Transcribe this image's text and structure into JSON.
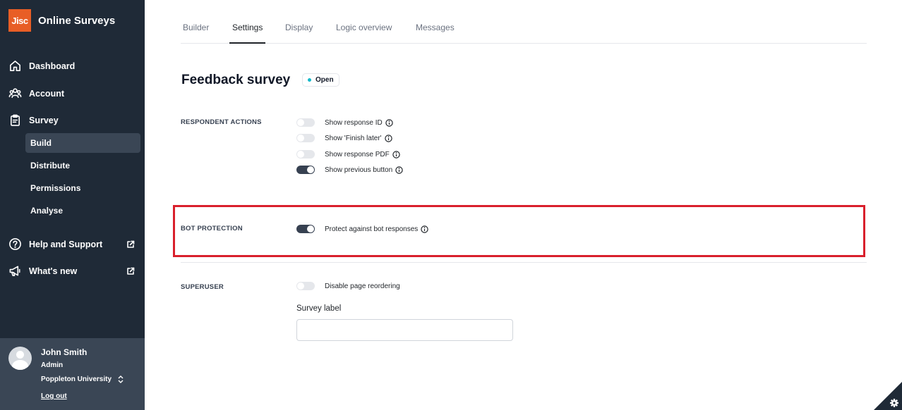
{
  "brand": {
    "logo_text": "Jisc",
    "app_name": "Online Surveys"
  },
  "nav": {
    "dashboard": "Dashboard",
    "account": "Account",
    "survey": "Survey",
    "survey_sub": [
      "Build",
      "Distribute",
      "Permissions",
      "Analyse"
    ],
    "help": "Help and Support",
    "whats_new": "What's new"
  },
  "user": {
    "name": "John Smith",
    "role": "Admin",
    "org": "Poppleton University",
    "logout": "Log out"
  },
  "tabs": [
    "Builder",
    "Settings",
    "Display",
    "Logic overview",
    "Messages"
  ],
  "active_tab": "Settings",
  "survey": {
    "title": "Feedback survey",
    "status": "Open"
  },
  "sections": {
    "respondent": {
      "label": "RESPONDENT ACTIONS",
      "options": [
        {
          "label": "Show response ID",
          "on": false
        },
        {
          "label": "Show 'Finish later'",
          "on": false
        },
        {
          "label": "Show response PDF",
          "on": false
        },
        {
          "label": "Show previous button",
          "on": true
        }
      ]
    },
    "bot": {
      "label": "BOT PROTECTION",
      "options": [
        {
          "label": "Protect against bot responses",
          "on": true
        }
      ]
    },
    "superuser": {
      "label": "SUPERUSER",
      "options": [
        {
          "label": "Disable page reordering",
          "on": false
        }
      ],
      "field_label": "Survey label",
      "field_value": ""
    }
  },
  "colors": {
    "sidebar": "#1f2a37",
    "accent": "#e85e26",
    "highlight": "#d9202c",
    "status_dot": "#14b8c9"
  }
}
